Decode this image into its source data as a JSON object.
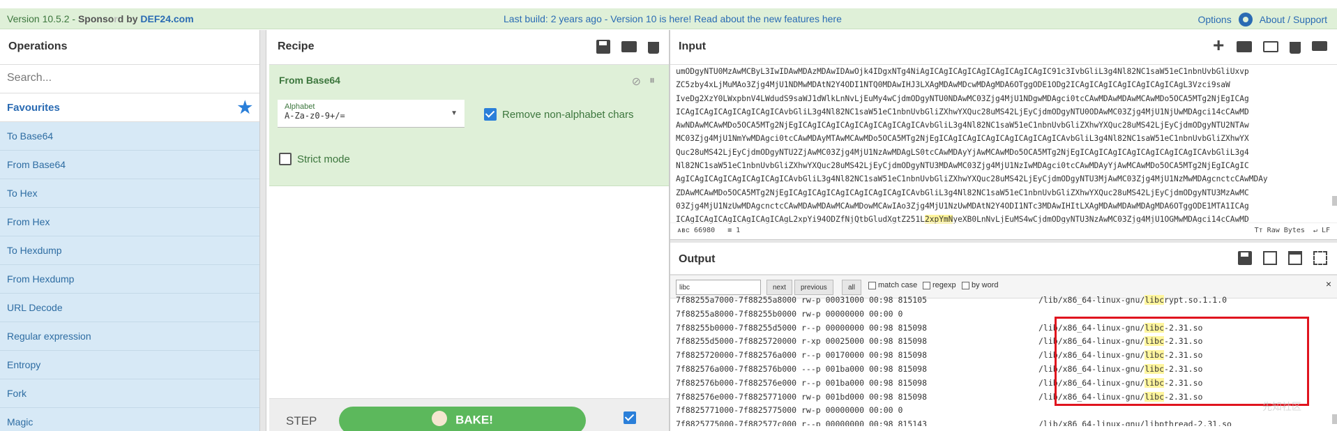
{
  "banner": {
    "version": "Version 10.5.2 - ",
    "sponsored": "Sponso",
    "sponsored_faded": "r",
    "by": "d by ",
    "def24": "DEF24.com",
    "center": "Last build: 2 years ago - Version 10 is here! Read about the new features here",
    "options": "Options",
    "about": "About / Support"
  },
  "operations": {
    "title": "Operations",
    "search_placeholder": "Search...",
    "favourites": "Favourites",
    "items": [
      "To Base64",
      "From Base64",
      "To Hex",
      "From Hex",
      "To Hexdump",
      "From Hexdump",
      "URL Decode",
      "Regular expression",
      "Entropy",
      "Fork",
      "Magic"
    ]
  },
  "recipe": {
    "title": "Recipe",
    "operation": "From Base64",
    "alphabet_label": "Alphabet",
    "alphabet_value": "A-Za-z0-9+/=",
    "remove_label": "Remove non-alphabet chars",
    "remove_checked": true,
    "strict_label": "Strict mode",
    "strict_checked": false,
    "step_label": "STEP",
    "bake_label": "BAKE!"
  },
  "input": {
    "title": "Input",
    "lines": [
      "umODgyNTU0MzAwMCByL3IwIDAwMDAzMDAwIDAwOjk4IDgxNTg4NiAgICAgICAgICAgICAgICAgICAgIC91c3IvbGliL3g4Nl82NC1saW51eC1nbnUvbGliUxvp",
      "ZC5zby4xLjMuMAo3Zjg4MjU1NDMwMDAtN2Y4ODI1NTQ0MDAwIHJ3LXAgMDAwMDcwMDAgMDA6OTggODE1ODg2ICAgICAgICAgICAgICAgICAgL3Vzci9saW",
      "IveDg2XzY0LWxpbnV4LWdudS9saWJ1dWlkLnNvLjEuMy4wCjdmODgyNTU0NDAwMC03Zjg4MjU1NDgwMDAgci0tcCAwMDAwMDAwMCAwMDo5OCA5MTg2NjEgICAg",
      "ICAgICAgICAgICAgICAgICAvbGliL3g4Nl82NC1saW51eC1nbnUvbGliZXhwYXQuc28uMS42LjEyCjdmODgyNTU0ODAwMC03Zjg4MjU1NjUwMDAgci14cCAwMD",
      "AwNDAwMCAwMDo5OCA5MTg2NjEgICAgICAgICAgICAgICAgICAgICAvbGliL3g4Nl82NC1saW51eC1nbnUvbGliZXhwYXQuc28uMS42LjEyCjdmODgyNTU2NTAw",
      "MC03Zjg4MjU1NmYwMDAgci0tcCAwMDAyMTAwMCAwMDo5OCA5MTg2NjEgICAgICAgICAgICAgICAgICAgICAvbGliL3g4Nl82NC1saW51eC1nbnUvbGliZXhwYX",
      "Quc28uMS42LjEyCjdmODgyNTU2ZjAwMC03Zjg4MjU1NzAwMDAgLS0tcCAwMDAyYjAwMCAwMDo5OCA5MTg2NjEgICAgICAgICAgICAgICAgICAgICAvbGliL3g4",
      "Nl82NC1saW51eC1nbnUvbGliZXhwYXQuc28uMS42LjEyCjdmODgyNTU3MDAwMC03Zjg4MjU1NzIwMDAgci0tcCAwMDAyYjAwMCAwMDo5OCA5MTg2NjEgICAgIC",
      "AgICAgICAgICAgICAgICAgICAvbGliL3g4Nl82NC1saW51eC1nbnUvbGliZXhwYXQuc28uMS42LjEyCjdmODgyNTU3MjAwMC03Zjg4MjU1NzMwMDAgcnctcCAwMDAy",
      "ZDAwMCAwMDo5OCA5MTg2NjEgICAgICAgICAgICAgICAgICAgICAvbGliL3g4Nl82NC1saW51eC1nbnUvbGliZXhwYXQuc28uMS42LjEyCjdmODgyNTU3MzAwMC",
      "03Zjg4MjU1NzUwMDAgcnctcCAwMDAwMDAwMCAwMDowMCAwIAo3Zjg4MjU1NzUwMDAtN2Y4ODI1NTc3MDAwIHItLXAgMDAwMDAwMDAgMDA6OTggODE1MTA1ICAg",
      "ICAgICAgICAgICAgICAgICAgL2xpYi94ODZfNjQtbGludXgtZ251L2xpYmNyeXB0LnNvLjEuMS4wCjdmODgyNTU3NzAwMC03Zjg4MjU1OGMwMDAgci14cCAwMD"
    ],
    "highlight": "2xpYmN",
    "status_left": "66980",
    "status_lines": "1",
    "status_raw": "Raw Bytes",
    "status_lf": "LF"
  },
  "output": {
    "title": "Output",
    "search_value": "libc",
    "btn_next": "next",
    "btn_previous": "previous",
    "btn_all": "all",
    "opt_match_case": "match case",
    "opt_regexp": "regexp",
    "opt_by_word": "by word",
    "rows": [
      {
        "left": "7f88255a7000-7f88255a8000 rw-p 00031000 00:98 815105",
        "pre": "/lib/x86_64-linux-gnu/",
        "hl": "libc",
        "post": "rypt.so.1.1.0"
      },
      {
        "left": "7f88255a8000-7f88255b0000 rw-p 00000000 00:00 0",
        "pre": "",
        "hl": "",
        "post": ""
      },
      {
        "left": "7f88255b0000-7f88255d5000 r--p 00000000 00:98 815098",
        "pre": "/lib/x86_64-linux-gnu/",
        "hl": "libc",
        "post": "-2.31.so"
      },
      {
        "left": "7f88255d5000-7f8825720000 r-xp 00025000 00:98 815098",
        "pre": "/lib/x86_64-linux-gnu/",
        "hl": "libc",
        "post": "-2.31.so"
      },
      {
        "left": "7f8825720000-7f882576a000 r--p 00170000 00:98 815098",
        "pre": "/lib/x86_64-linux-gnu/",
        "hl": "libc",
        "post": "-2.31.so"
      },
      {
        "left": "7f882576a000-7f882576b000 ---p 001ba000 00:98 815098",
        "pre": "/lib/x86_64-linux-gnu/",
        "hl": "libc",
        "post": "-2.31.so"
      },
      {
        "left": "7f882576b000-7f882576e000 r--p 001ba000 00:98 815098",
        "pre": "/lib/x86_64-linux-gnu/",
        "hl": "libc",
        "post": "-2.31.so"
      },
      {
        "left": "7f882576e000-7f8825771000 rw-p 001bd000 00:98 815098",
        "pre": "/lib/x86_64-linux-gnu/",
        "hl": "libc",
        "post": "-2.31.so"
      },
      {
        "left": "7f8825771000-7f8825775000 rw-p 00000000 00:00 0",
        "pre": "",
        "hl": "",
        "post": ""
      },
      {
        "left": "7f8825775000-7f882577c000 r--p 00000000 00:98 815143",
        "pre": "/lib/x86_64-linux-gnu/libpthread-2.31.so",
        "hl": "",
        "post": ""
      }
    ]
  },
  "watermark": "先知社区",
  "colors": {
    "banner_bg": "#dff0d8",
    "op_list_bg": "#d7e9f6",
    "recipe_card_bg": "#dff0d8",
    "bake_green": "#5cb85c",
    "highlight": "#fff59d",
    "annotation_red": "#e0141e",
    "link_blue": "#2a6bb3"
  },
  "icons": [
    "gear-icon",
    "star-icon",
    "save-icon",
    "folder-icon",
    "trash-icon",
    "plus-icon",
    "disable-icon",
    "pause-icon",
    "chef-icon"
  ]
}
